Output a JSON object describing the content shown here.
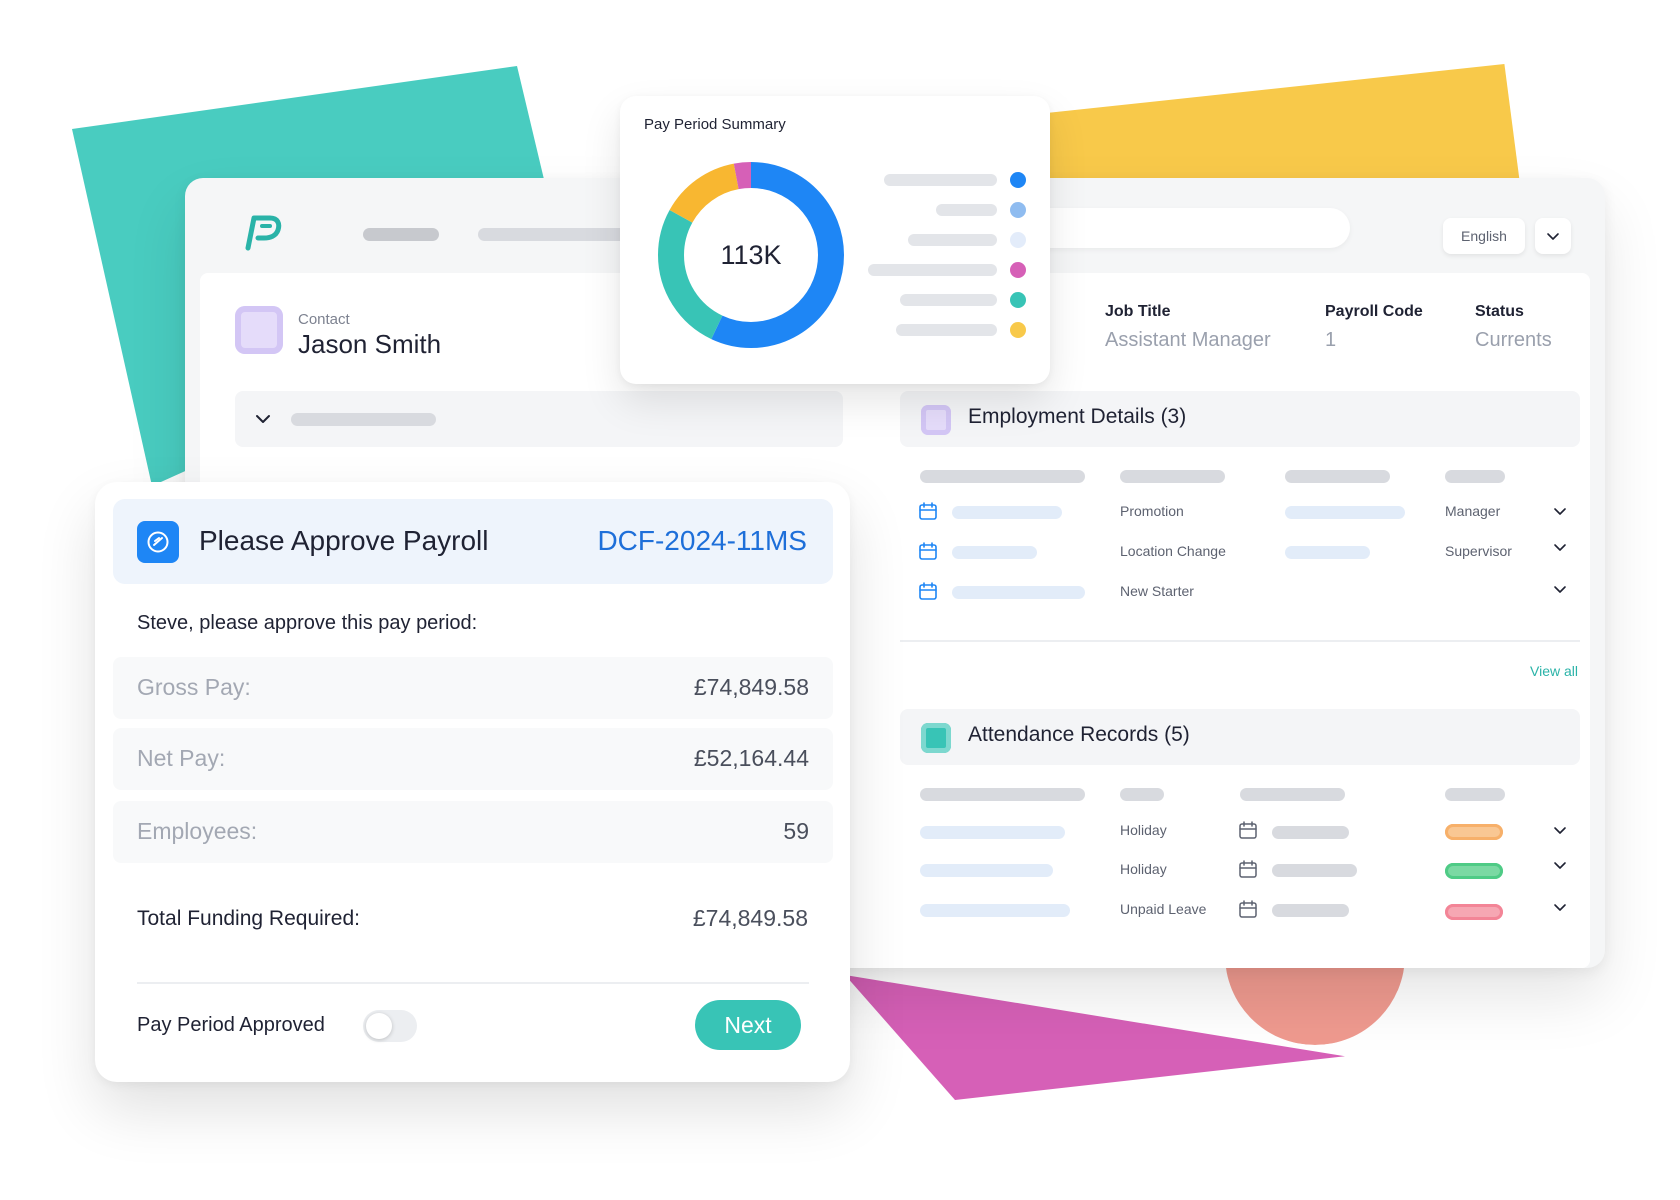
{
  "colors": {
    "accent_blue": "#1e86f5",
    "teal": "#38c4b6",
    "yellow": "#f8c94a",
    "pink": "#d660b7",
    "purple_light": "#e5dcfa"
  },
  "header": {
    "language": "English"
  },
  "contact": {
    "label": "Contact",
    "name": "Jason Smith"
  },
  "job_info": {
    "job_title_label": "Job Title",
    "job_title_value": "Assistant Manager",
    "payroll_code_label": "Payroll Code",
    "payroll_code_value": "1",
    "status_label": "Status",
    "status_value": "Currents"
  },
  "employment": {
    "title": "Employment Details (3)",
    "rows": [
      {
        "type": "Promotion",
        "role": "Manager"
      },
      {
        "type": "Location Change",
        "role": "Supervisor"
      },
      {
        "type": "New Starter",
        "role": ""
      }
    ],
    "view_all": "View all"
  },
  "attendance": {
    "title": "Attendance Records (5)",
    "rows": [
      {
        "type": "Holiday",
        "status_color": "#f9c793"
      },
      {
        "type": "Holiday",
        "status_color": "#7bd9a3"
      },
      {
        "type": "Unpaid Leave",
        "status_color": "#f6a7b3"
      }
    ]
  },
  "summary": {
    "title": "Pay Period Summary",
    "center_value": "113K",
    "legend_colors": [
      "#1e86f5",
      "#8fbcf0",
      "#e3ecfa",
      "#d660b7",
      "#38c4b6",
      "#f8c94a"
    ]
  },
  "chart_data": {
    "type": "pie",
    "title": "Pay Period Summary",
    "center_label": "113K",
    "series": [
      {
        "color": "#1e86f5",
        "value": 57
      },
      {
        "color": "#38c4b6",
        "value": 26
      },
      {
        "color": "#f8b731",
        "value": 14
      },
      {
        "color": "#d660b7",
        "value": 3
      }
    ]
  },
  "approval": {
    "title": "Please Approve Payroll",
    "code": "DCF-2024-11MS",
    "prompt": "Steve, please approve this pay period:",
    "gross_label": "Gross Pay:",
    "gross_value": "£74,849.58",
    "net_label": "Net Pay:",
    "net_value": "£52,164.44",
    "employees_label": "Employees:",
    "employees_value": "59",
    "total_label": "Total Funding Required:",
    "total_value": "£74,849.58",
    "toggle_label": "Pay Period Approved",
    "toggle_on": false,
    "next_label": "Next"
  }
}
